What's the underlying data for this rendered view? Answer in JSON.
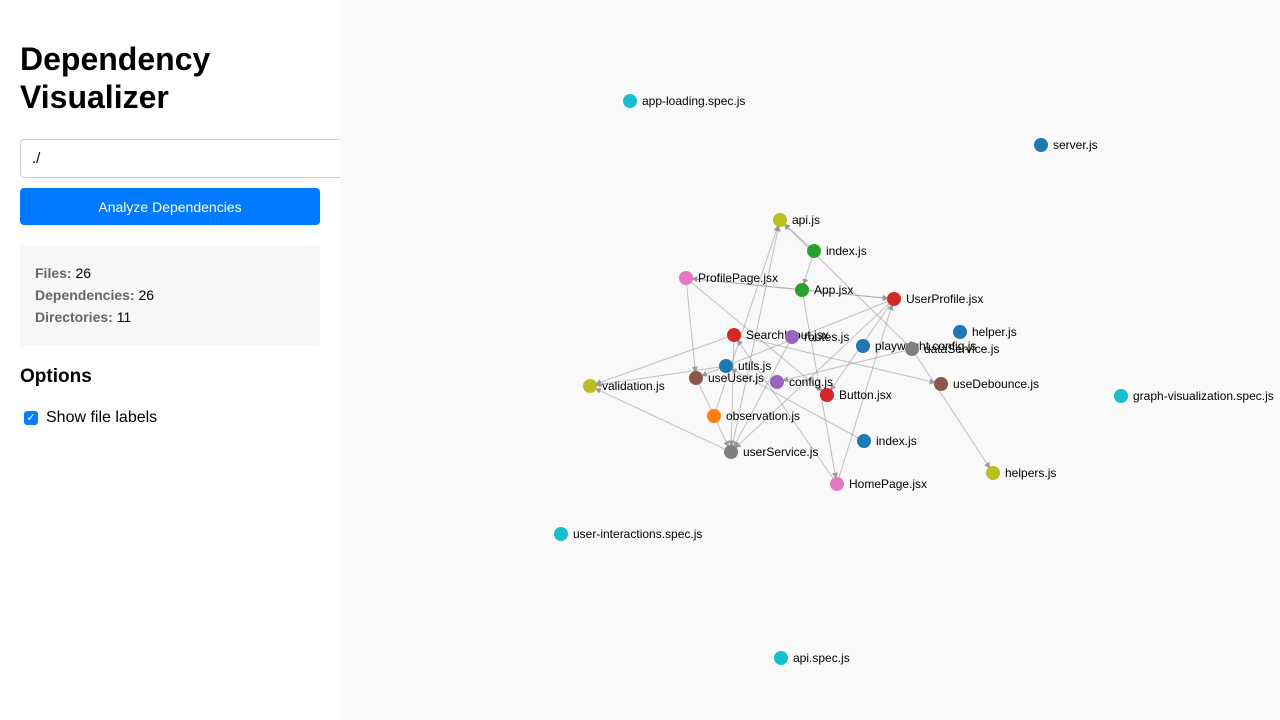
{
  "app": {
    "title": "Dependency Visualizer"
  },
  "controls": {
    "path_value": "./",
    "analyze_label": "Analyze Dependencies"
  },
  "stats": {
    "files_label": "Files:",
    "files_value": "26",
    "dependencies_label": "Dependencies:",
    "dependencies_value": "26",
    "directories_label": "Directories:",
    "directories_value": "11"
  },
  "options": {
    "heading": "Options",
    "show_labels_label": "Show file labels",
    "show_labels_checked": true
  },
  "graph": {
    "nodes": [
      {
        "id": "app-loading",
        "label": "app-loading.spec.js",
        "color": "#17becf"
      },
      {
        "id": "server",
        "label": "server.js",
        "color": "#1f77b4"
      },
      {
        "id": "api",
        "label": "api.js",
        "color": "#bcbd22"
      },
      {
        "id": "index1",
        "label": "index.js",
        "color": "#2ca02c"
      },
      {
        "id": "profilepage",
        "label": "ProfilePage.jsx",
        "color": "#e377c2"
      },
      {
        "id": "appjsx",
        "label": "App.jsx",
        "color": "#2ca02c"
      },
      {
        "id": "userprofile",
        "label": "UserProfile.jsx",
        "color": "#d62728"
      },
      {
        "id": "helper",
        "label": "helper.js",
        "color": "#1f77b4"
      },
      {
        "id": "search",
        "label": "SearchInput.jsx",
        "color": "#d62728"
      },
      {
        "id": "routes",
        "label": "routes.js",
        "color": "#9467bd"
      },
      {
        "id": "playwright",
        "label": "playwright.config.js",
        "color": "#1f77b4"
      },
      {
        "id": "dataservice",
        "label": "dataService.js",
        "color": "#7f7f7f"
      },
      {
        "id": "utils",
        "label": "utils.js",
        "color": "#1f77b4"
      },
      {
        "id": "validation",
        "label": "validation.js",
        "color": "#bcbd22"
      },
      {
        "id": "useuser",
        "label": "useUser.js",
        "color": "#8c564b"
      },
      {
        "id": "config",
        "label": "config.js",
        "color": "#9467bd"
      },
      {
        "id": "usedebounce",
        "label": "useDebounce.js",
        "color": "#8c564b"
      },
      {
        "id": "graphvis",
        "label": "graph-visualization.spec.js",
        "color": "#17becf"
      },
      {
        "id": "button",
        "label": "Button.jsx",
        "color": "#d62728"
      },
      {
        "id": "observation",
        "label": "observation.js",
        "color": "#ff7f0e"
      },
      {
        "id": "index2",
        "label": "index.js",
        "color": "#1f77b4"
      },
      {
        "id": "userservice",
        "label": "userService.js",
        "color": "#7f7f7f"
      },
      {
        "id": "helpers",
        "label": "helpers.js",
        "color": "#bcbd22"
      },
      {
        "id": "homepage",
        "label": "HomePage.jsx",
        "color": "#e377c2"
      },
      {
        "id": "userinteractions",
        "label": "user-interactions.spec.js",
        "color": "#17becf"
      },
      {
        "id": "apispec",
        "label": "api.spec.js",
        "color": "#17becf"
      }
    ],
    "edges": [
      [
        "index1",
        "api"
      ],
      [
        "index1",
        "appjsx"
      ],
      [
        "appjsx",
        "profilepage"
      ],
      [
        "appjsx",
        "userprofile"
      ],
      [
        "appjsx",
        "homepage"
      ],
      [
        "profilepage",
        "userprofile"
      ],
      [
        "profilepage",
        "useuser"
      ],
      [
        "profilepage",
        "button"
      ],
      [
        "userprofile",
        "useuser"
      ],
      [
        "userprofile",
        "button"
      ],
      [
        "userprofile",
        "userservice"
      ],
      [
        "search",
        "usedebounce"
      ],
      [
        "search",
        "validation"
      ],
      [
        "search",
        "userservice"
      ],
      [
        "homepage",
        "search"
      ],
      [
        "homepage",
        "userprofile"
      ],
      [
        "useuser",
        "userservice"
      ],
      [
        "userservice",
        "api"
      ],
      [
        "userservice",
        "validation"
      ],
      [
        "dataservice",
        "api"
      ],
      [
        "dataservice",
        "helpers"
      ],
      [
        "dataservice",
        "config"
      ],
      [
        "index2",
        "utils"
      ],
      [
        "routes",
        "userservice"
      ],
      [
        "utils",
        "validation"
      ],
      [
        "observation",
        "api"
      ]
    ]
  }
}
